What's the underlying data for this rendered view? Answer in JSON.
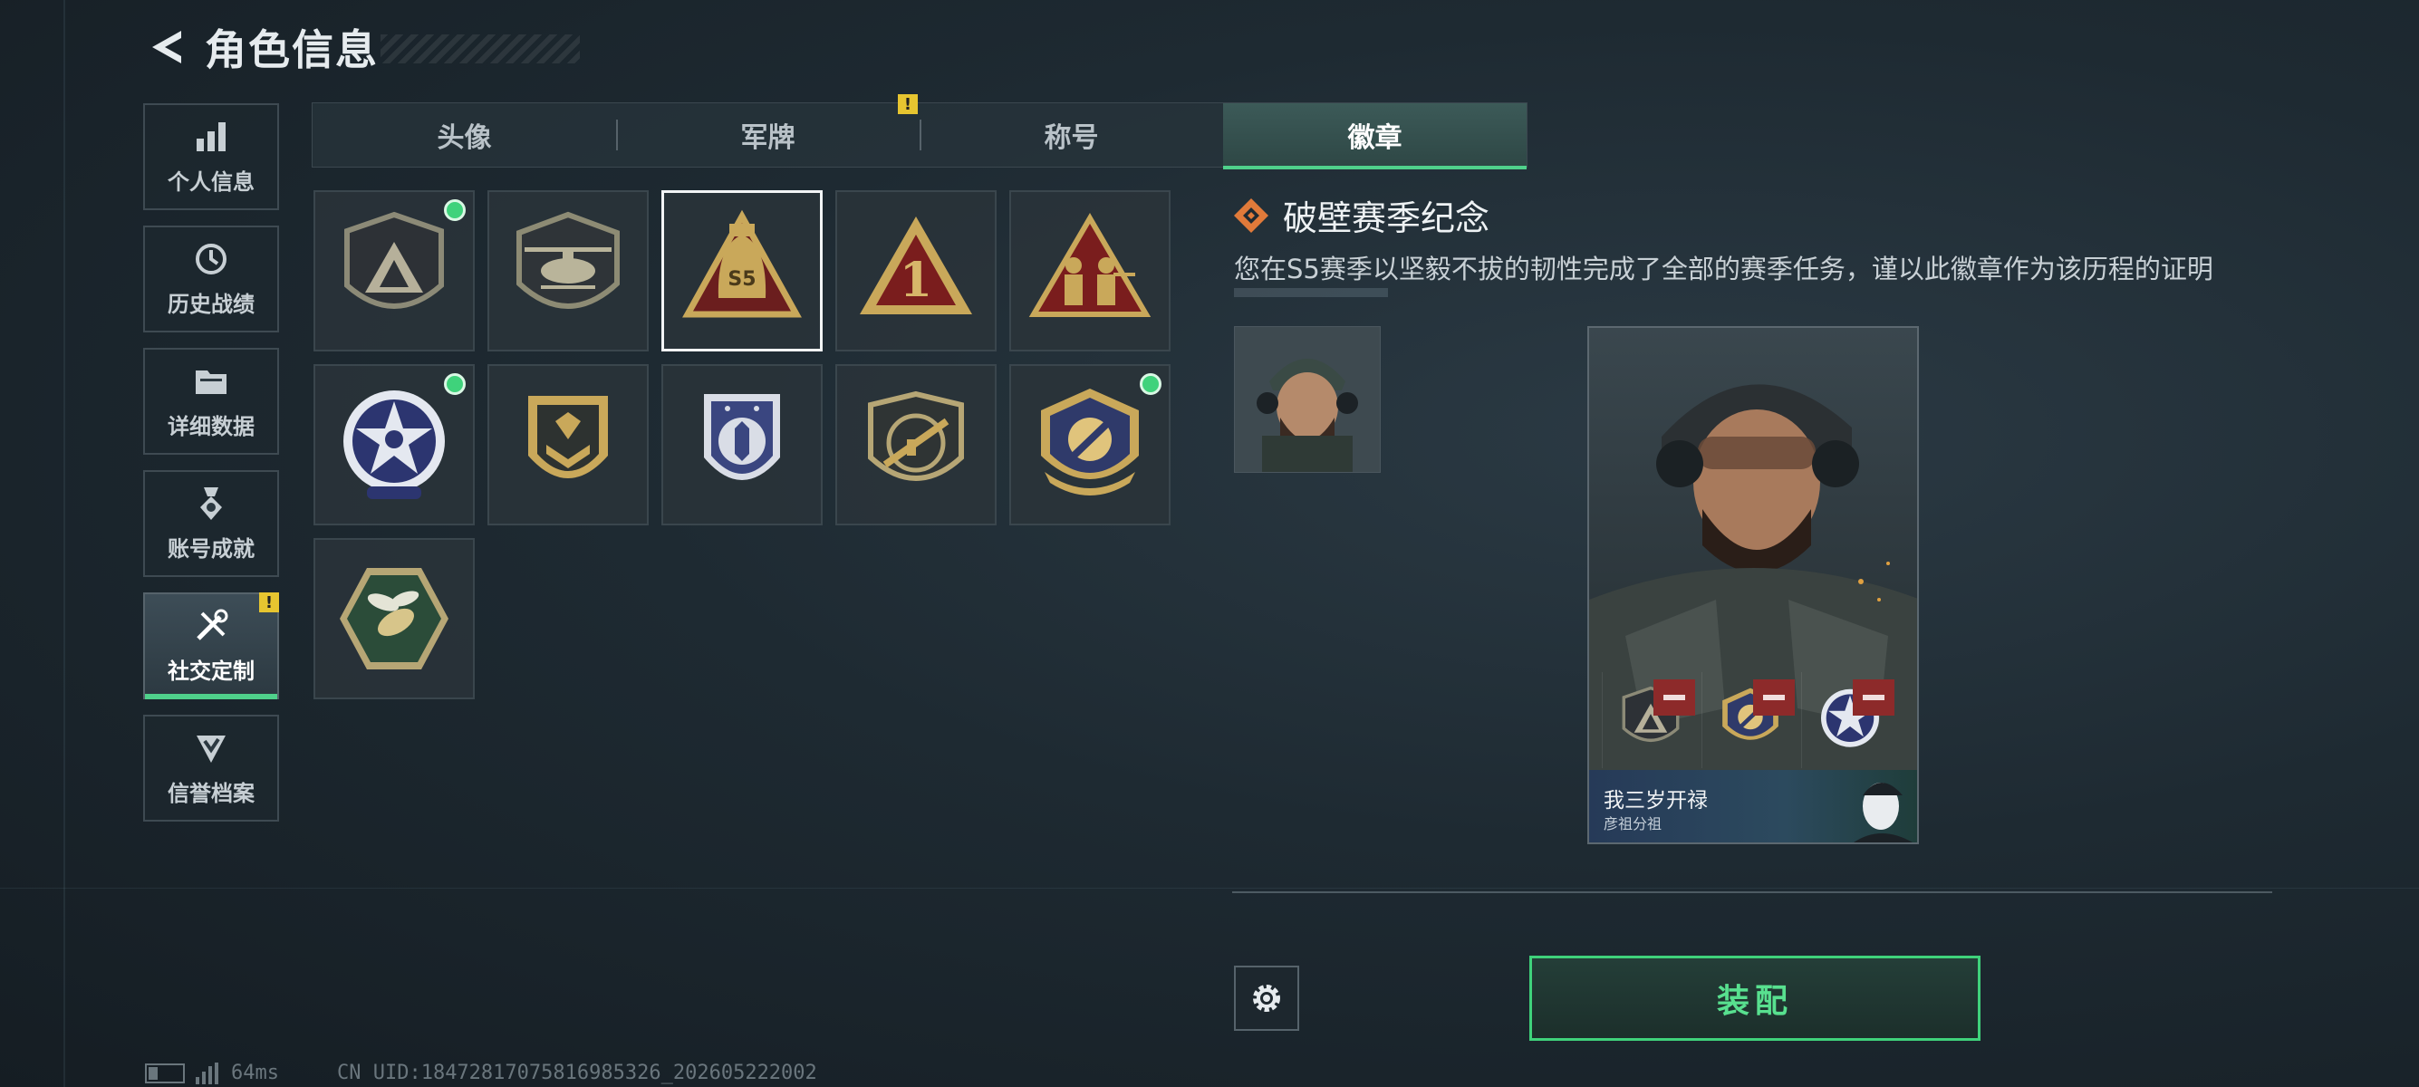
{
  "header": {
    "title": "角色信息"
  },
  "sidebar": {
    "items": [
      {
        "label": "个人信息",
        "icon": "bar-chart-icon",
        "active": false
      },
      {
        "label": "历史战绩",
        "icon": "clock-history-icon",
        "active": false
      },
      {
        "label": "详细数据",
        "icon": "folder-icon",
        "active": false
      },
      {
        "label": "账号成就",
        "icon": "medal-icon",
        "active": false
      },
      {
        "label": "社交定制",
        "icon": "tools-icon",
        "active": true,
        "alert": "!"
      },
      {
        "label": "信誉档案",
        "icon": "shield-check-icon",
        "active": false
      }
    ]
  },
  "tabs": [
    {
      "label": "头像",
      "active": false
    },
    {
      "label": "军牌",
      "active": false,
      "alert": "!"
    },
    {
      "label": "称号",
      "active": false
    },
    {
      "label": "徽章",
      "active": true
    }
  ],
  "badges": [
    {
      "name": "triangle-shield-badge",
      "equipped": true,
      "selected": false
    },
    {
      "name": "helicopter-badge",
      "equipped": false,
      "selected": false
    },
    {
      "name": "s5-bell-badge",
      "equipped": false,
      "selected": true,
      "text": "S5"
    },
    {
      "name": "number-one-badge",
      "equipped": false,
      "selected": false,
      "text": "1"
    },
    {
      "name": "soldiers-badge",
      "equipped": false,
      "selected": false
    },
    {
      "name": "star-alien-badge",
      "equipped": true,
      "selected": false
    },
    {
      "name": "chevron-shield-badge",
      "equipped": false,
      "selected": false
    },
    {
      "name": "blue-crest-badge",
      "equipped": false,
      "selected": false
    },
    {
      "name": "rifle-badge",
      "equipped": false,
      "selected": false
    },
    {
      "name": "gold-rocket-badge",
      "equipped": true,
      "selected": false
    },
    {
      "name": "wasp-badge",
      "equipped": false,
      "selected": false
    }
  ],
  "detail": {
    "title": "破壁赛季纪念",
    "description": "您在S5赛季以坚毅不拔的韧性完成了全部的赛季任务，谨以此徽章作为该历程的证明"
  },
  "card": {
    "player_name": "我三岁开禄",
    "group_name": "彦祖分祖",
    "equipped_badges": [
      "triangle-shield-badge",
      "gold-rocket-badge",
      "star-alien-badge"
    ]
  },
  "actions": {
    "equip_label": "装配"
  },
  "status": {
    "ping": "64ms",
    "uid": "CN UID:18472817075816985326_202605222002"
  },
  "colors": {
    "accent_green": "#4fd18b",
    "alert_yellow": "#e7c530",
    "remove_red": "#8d2a2a",
    "badge_gold": "#c9a85a"
  }
}
